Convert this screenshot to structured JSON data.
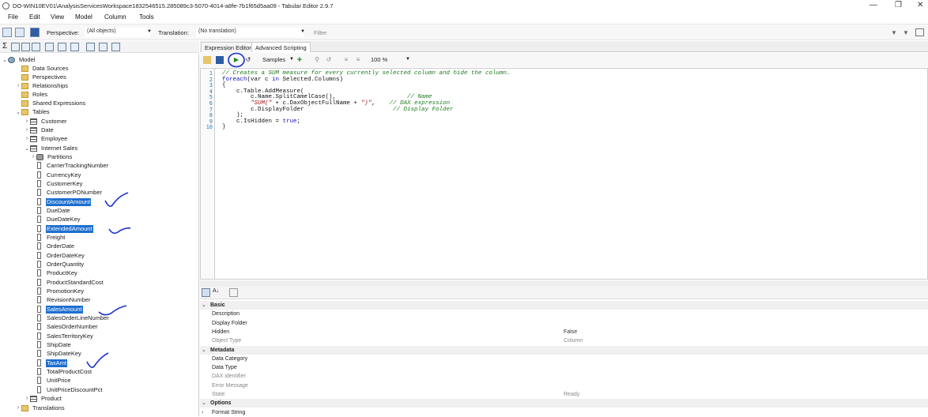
{
  "window": {
    "title": "DO-WIN10EV01\\AnalysisServicesWorkspace1832546515.285089c3-5070-4014-a8fe-7b1f65d5aa09 - Tabular Editor 2.9.7",
    "minimize": "—",
    "restore": "❐",
    "close": "✕"
  },
  "menu": [
    "File",
    "Edit",
    "View",
    "Model",
    "Column",
    "Tools"
  ],
  "toolbar": {
    "perspective_label": "Perspective:",
    "perspective_value": "(All objects)",
    "translation_label": "Translation:",
    "translation_value": "(No translation)",
    "filter_placeholder": "Filter"
  },
  "tabs": {
    "expression_editor": "Expression Editor",
    "advanced_scripting": "Advanced Scripting"
  },
  "script_toolbar": {
    "samples": "Samples",
    "zoom": "100 %"
  },
  "tree": {
    "model": "Model",
    "model_children": [
      "Data Sources",
      "Perspectives",
      "Relationships",
      "Roles",
      "Shared Expressions",
      "Tables"
    ],
    "tables": [
      "Customer",
      "Date",
      "Employee",
      "Internet Sales"
    ],
    "partitions": "Partitions",
    "columns": [
      "CarrierTrackingNumber",
      "CurrencyKey",
      "CustomerKey",
      "CustomerPONumber",
      "DiscountAmount",
      "DueDate",
      "DueDateKey",
      "ExtendedAmount",
      "Freight",
      "OrderDate",
      "OrderDateKey",
      "OrderQuantity",
      "ProductKey",
      "ProductStandardCost",
      "PromotionKey",
      "RevisionNumber",
      "SalesAmount",
      "SalesOrderLineNumber",
      "SalesOrderNumber",
      "SalesTerritoryKey",
      "ShipDate",
      "ShipDateKey",
      "TaxAmt",
      "TotalProductCost",
      "UnitPrice",
      "UnitPriceDiscountPct"
    ],
    "selected_columns": [
      "DiscountAmount",
      "ExtendedAmount",
      "SalesAmount",
      "TaxAmt"
    ],
    "product": "Product",
    "translations": "Translations"
  },
  "script_lines": [
    {
      "n": "1",
      "parts": [
        [
          "cm",
          "// Creates a SUM measure for every currently selected column and hide the column."
        ]
      ]
    },
    {
      "n": "2",
      "parts": [
        [
          "kw",
          "foreach"
        ],
        [
          "",
          "(var c "
        ],
        [
          "kw",
          "in"
        ],
        [
          "",
          " Selected.Columns)"
        ]
      ]
    },
    {
      "n": "3",
      "parts": [
        [
          "",
          "{"
        ]
      ]
    },
    {
      "n": "4",
      "parts": [
        [
          "",
          "    c.Table.AddMeasure("
        ]
      ]
    },
    {
      "n": "5",
      "parts": [
        [
          "",
          "        c.Name.SplitCamelCase(),                    "
        ],
        [
          "cm",
          "// Name"
        ]
      ]
    },
    {
      "n": "6",
      "parts": [
        [
          "",
          "        "
        ],
        [
          "st",
          "\"SUM(\""
        ],
        [
          "",
          " + c.DaxObjectFullName + "
        ],
        [
          "st",
          "\")\""
        ],
        [
          "",
          ",    "
        ],
        [
          "cm",
          "// DAX expression"
        ]
      ]
    },
    {
      "n": "7",
      "parts": [
        [
          "",
          "        c.DisplayFolder                         "
        ],
        [
          "cm",
          "// Display Folder"
        ]
      ]
    },
    {
      "n": "8",
      "parts": [
        [
          "",
          "    );"
        ]
      ]
    },
    {
      "n": "9",
      "parts": [
        [
          "",
          "    c.IsHidden = "
        ],
        [
          "kw",
          "true"
        ],
        [
          "",
          ";"
        ]
      ]
    },
    {
      "n": "10",
      "parts": [
        [
          "",
          "}"
        ]
      ]
    }
  ],
  "properties": [
    {
      "kind": "cat",
      "name": "Basic"
    },
    {
      "kind": "row",
      "name": "Description",
      "value": ""
    },
    {
      "kind": "row",
      "name": "Display Folder",
      "value": ""
    },
    {
      "kind": "row",
      "name": "Hidden",
      "value": "False"
    },
    {
      "kind": "row",
      "name": "Object Type",
      "value": "Column",
      "dim": true
    },
    {
      "kind": "cat",
      "name": "Metadata"
    },
    {
      "kind": "row",
      "name": "Data Category",
      "value": ""
    },
    {
      "kind": "row",
      "name": "Data Type",
      "value": ""
    },
    {
      "kind": "row",
      "name": "DAX identifier",
      "value": "",
      "dim": true
    },
    {
      "kind": "row",
      "name": "Error Message",
      "value": "",
      "dim": true
    },
    {
      "kind": "row",
      "name": "State",
      "value": "Ready",
      "dim": true
    },
    {
      "kind": "cat",
      "name": "Options"
    },
    {
      "kind": "row",
      "name": "Format String",
      "value": "",
      "expand": true
    }
  ],
  "colors": {
    "selection": "#1e6fd0",
    "annotation_ink": "#1a2fd0"
  }
}
